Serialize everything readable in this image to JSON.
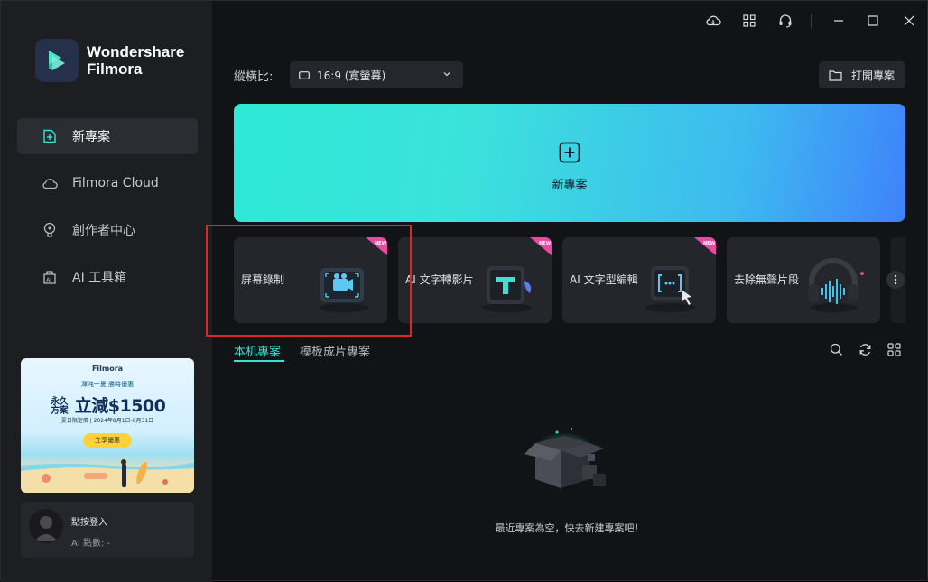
{
  "app": {
    "name_line1": "Wondershare",
    "name_line2": "Filmora"
  },
  "sidebar": {
    "items": [
      {
        "label": "新專案",
        "icon": "new-project-icon",
        "active": true
      },
      {
        "label": "Filmora Cloud",
        "icon": "cloud-icon",
        "active": false
      },
      {
        "label": "創作者中心",
        "icon": "lightbulb-icon",
        "active": false
      },
      {
        "label": "AI 工具箱",
        "icon": "ai-toolbox-icon",
        "active": false
      }
    ],
    "promo": {
      "brand": "Filmora",
      "subtitle": "渾沌一夏 勝時優惠",
      "main_small": "永久方案",
      "main_big": "立減$1500",
      "date": "夏日限定價 | 2024年8月1日-8月31日",
      "button": "立享優惠"
    },
    "user": {
      "login": "點按登入",
      "ai_points": "AI 點數: -"
    }
  },
  "titlebar": {
    "icons": [
      "cloud-download-icon",
      "grid-apps-icon",
      "headset-icon",
      "minimize-icon",
      "maximize-icon",
      "close-icon"
    ]
  },
  "aspect": {
    "label": "縱橫比:",
    "value": "16:9 (寬螢幕)"
  },
  "open_project": {
    "label": "打開專案"
  },
  "hero": {
    "label": "新專案"
  },
  "tools": [
    {
      "label": "屏幕錄制",
      "badge": "NEW"
    },
    {
      "label": "AI 文字轉影片",
      "badge": "NEW"
    },
    {
      "label": "AI 文字型編輯",
      "badge": "NEW"
    },
    {
      "label": "去除無聲片段",
      "badge": ""
    }
  ],
  "tabs": [
    {
      "label": "本机專案",
      "active": true
    },
    {
      "label": "模板成片專案",
      "active": false
    }
  ],
  "empty": {
    "message": "最近專案為空，快去新建專案吧！"
  },
  "colors": {
    "accent": "#34e3d0",
    "highlight": "#e0242a",
    "hero_start": "#2de9d6",
    "hero_end": "#3f82fb"
  }
}
